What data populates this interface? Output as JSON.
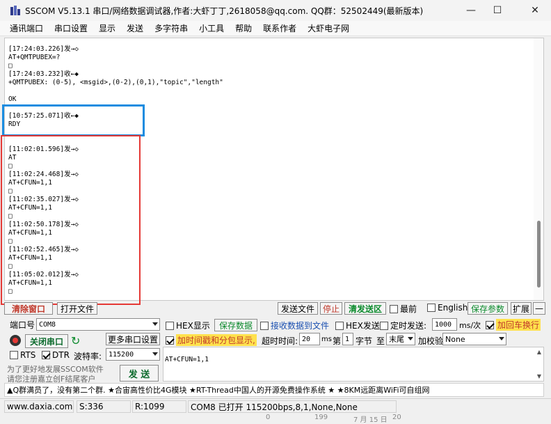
{
  "window": {
    "title": "SSCOM V5.13.1 串口/网络数据调试器,作者:大虾丁丁,2618058@qq.com. QQ群：52502449(最新版本)",
    "minimize": "—",
    "maximize": "☐",
    "close": "✕"
  },
  "menu": [
    "通讯端口",
    "串口设置",
    "显示",
    "发送",
    "多字符串",
    "小工具",
    "帮助",
    "联系作者",
    "大虾电子网"
  ],
  "terminal": {
    "lines": [
      "[17:24:03.226]发→◇",
      "AT+QMTPUBEX=?",
      "□",
      "[17:24:03.232]收←◆",
      "+QMTPUBEX: (0-5), <msgid>,(0-2),(0,1),\"topic\",\"length\"",
      "",
      "OK",
      "",
      "[10:57:25.071]收←◆",
      "RDY",
      "",
      "",
      "[11:02:01.596]发→◇",
      "AT",
      "□",
      "[11:02:24.468]发→◇",
      "AT+CFUN=1,1",
      "□",
      "[11:02:35.027]发→◇",
      "AT+CFUN=1,1",
      "□",
      "[11:02:50.178]发→◇",
      "AT+CFUN=1,1",
      "□",
      "[11:02:52.465]发→◇",
      "AT+CFUN=1,1",
      "□",
      "[11:05:02.012]发→◇",
      "AT+CFUN=1,1",
      "□"
    ]
  },
  "controls": {
    "clear_window": "清除窗口",
    "open_file": "打开文件",
    "send_file": "发送文件",
    "stop": "停止",
    "clear_send": "清发送区",
    "last": "最前",
    "english": "English",
    "save_params": "保存参数",
    "expand": "扩展",
    "collapse": "—",
    "port_label": "端口号",
    "port_value": "COM8",
    "hex_display": "HEX显示",
    "save_data": "保存数据",
    "recv_to_file": "接收数据到文件",
    "hex_send": "HEX发送",
    "timed_send": "定时发送:",
    "timed_value": "1000",
    "timed_unit": "ms/次",
    "add_crlf": "加回车换行",
    "close_port": "关闭串口",
    "more_settings": "更多串口设置",
    "timestamp_split": "加时间戳和分包显示,",
    "timeout_label": "超时时间:",
    "timeout_value": "20",
    "timeout_unit": "ms",
    "byte_label": "第",
    "byte_value": "1",
    "byte_unit": "字节",
    "to_label": "至",
    "end_value": "末尾",
    "checksum_label": "加校验",
    "checksum_value": "None",
    "rts": "RTS",
    "dtr": "DTR",
    "baud_label": "波特率:",
    "baud_value": "115200",
    "promo_line1": "为了更好地发展SSCOM软件",
    "promo_line2": "请您注册嘉立创F结尾客户",
    "send": "发 送",
    "send_input": "AT+CFUN=1,1"
  },
  "marquee": "▲Q群满员了，没有第二个群. ★合宙高性价比4G模块 ★RT-Thread中国人的开源免费操作系统 ★ ★8KM远距离WiFi可自组网",
  "status": {
    "site": "www.daxia.com",
    "sent": "S:336",
    "received": "R:1099",
    "port_status": "COM8 已打开  115200bps,8,1,None,None"
  },
  "below_window": [
    "0",
    "199",
    "7 月 15 日",
    "20"
  ],
  "colors": {
    "highlight_blue": "#1a8ce0",
    "highlight_red": "#e53935",
    "accent_green": "#0b8a2c",
    "accent_yellow": "#ffe14d"
  }
}
